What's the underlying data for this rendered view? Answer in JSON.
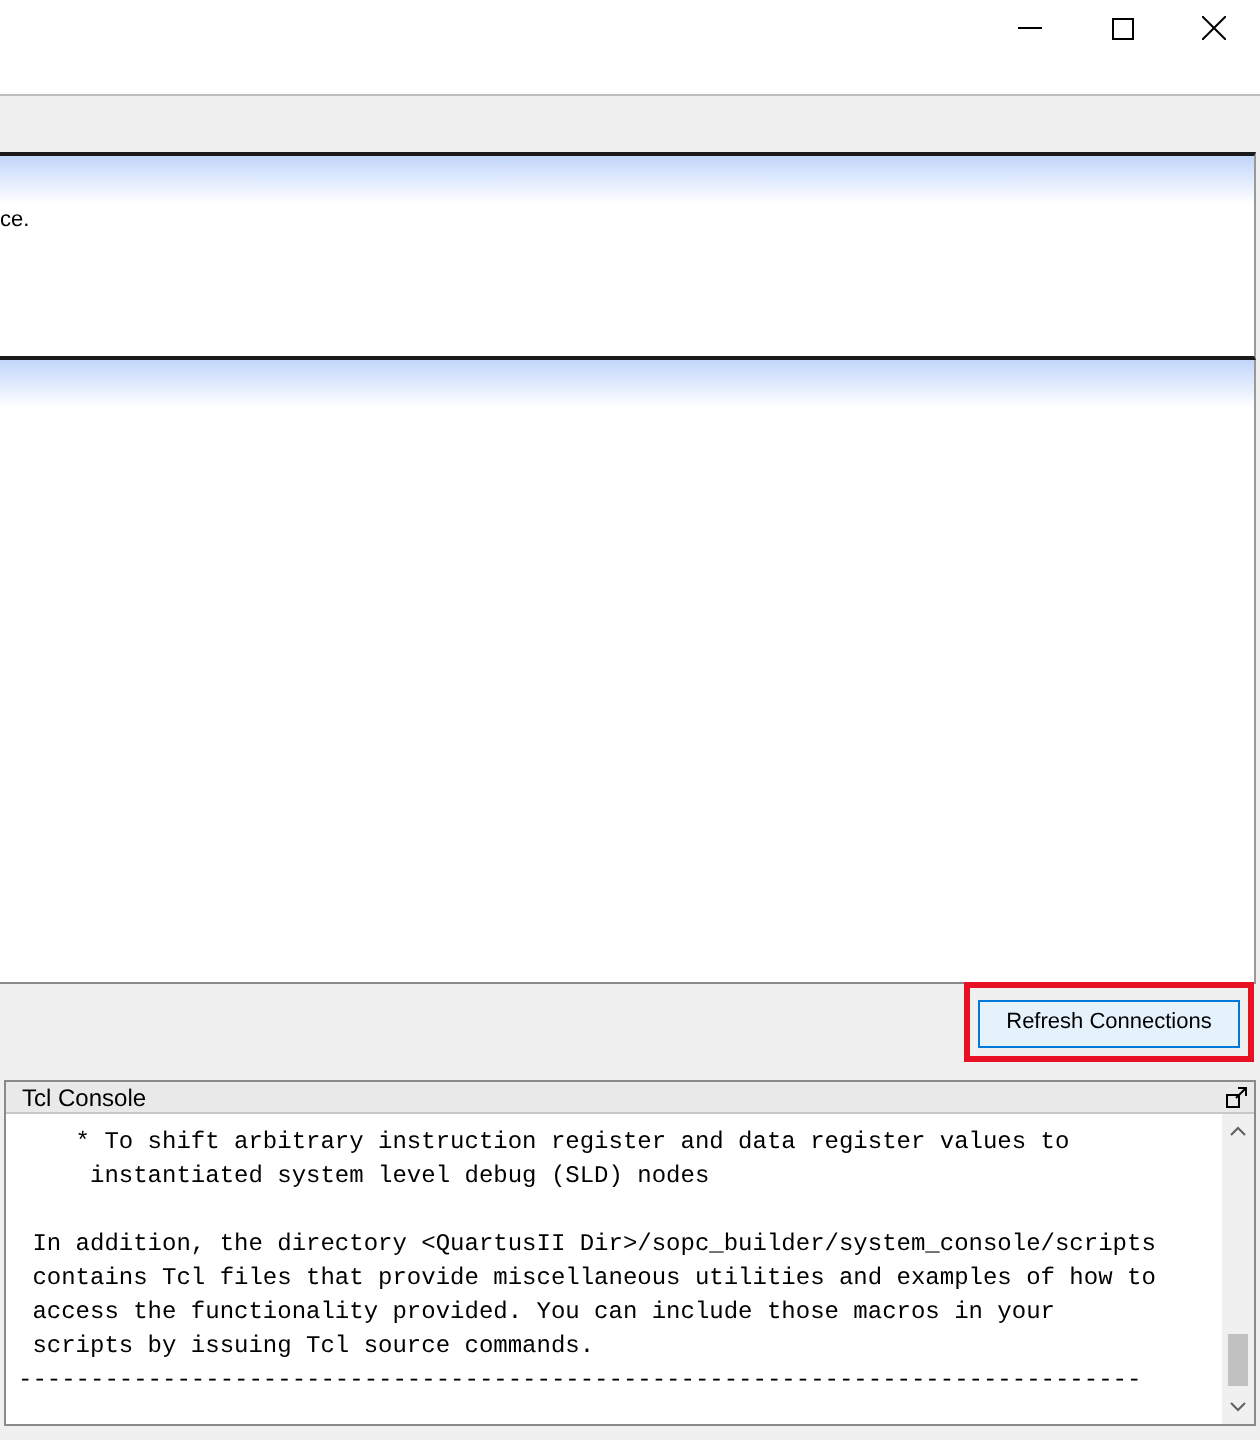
{
  "info_panel": {
    "text": "ce."
  },
  "refresh_button": {
    "label": "Refresh Connections",
    "highlighted": true
  },
  "tcl_console": {
    "title": "Tcl Console",
    "paragraphs": [
      [
        "    * To shift arbitrary instruction register and data register values to",
        "     instantiated system level debug (SLD) nodes"
      ],
      [
        " In addition, the directory <QuartusII Dir>/sopc_builder/system_console/scripts",
        " contains Tcl files that provide miscellaneous utilities and examples of how to",
        " access the functionality provided. You can include those macros in your",
        " scripts by issuing Tcl source commands.",
        "------------------------------------------------------------------------------"
      ]
    ]
  }
}
